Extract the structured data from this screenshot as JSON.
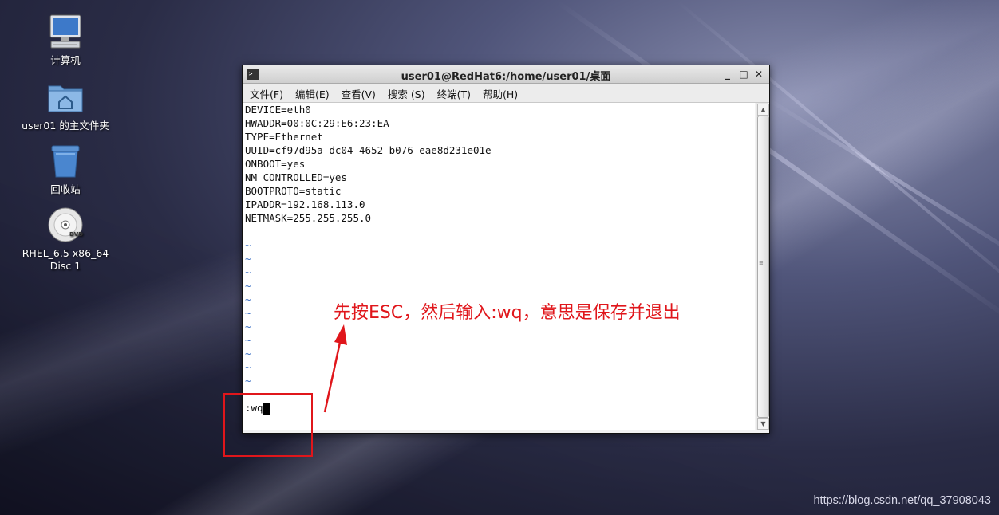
{
  "desktop": {
    "icons": [
      {
        "label": "计算机",
        "icon": "computer-icon"
      },
      {
        "label": "user01 的主文件夹",
        "icon": "home-folder-icon"
      },
      {
        "label": "回收站",
        "icon": "trash-icon"
      },
      {
        "label_line1": "RHEL_6.5 x86_64",
        "label_line2": "Disc 1",
        "icon": "dvd-icon"
      }
    ]
  },
  "window": {
    "title": "user01@RedHat6:/home/user01/桌面",
    "controls": {
      "minimize": "_",
      "maximize": "□",
      "close": "✕"
    },
    "menu": [
      "文件(F)",
      "编辑(E)",
      "查看(V)",
      "搜索 (S)",
      "终端(T)",
      "帮助(H)"
    ],
    "lines": [
      "DEVICE=eth0",
      "HWADDR=00:0C:29:E6:23:EA",
      "TYPE=Ethernet",
      "UUID=cf97d95a-dc04-4652-b076-eae8d231e01e",
      "ONBOOT=yes",
      "NM_CONTROLLED=yes",
      "BOOTPROTO=static",
      "IPADDR=192.168.113.0",
      "NETMASK=255.255.255.0",
      ""
    ],
    "tilde": "~",
    "command": ":wq"
  },
  "annotation": {
    "text": "先按ESC，然后输入:wq，意思是保存并退出",
    "color": "#e0161b"
  },
  "watermark": "https://blog.csdn.net/qq_37908043"
}
